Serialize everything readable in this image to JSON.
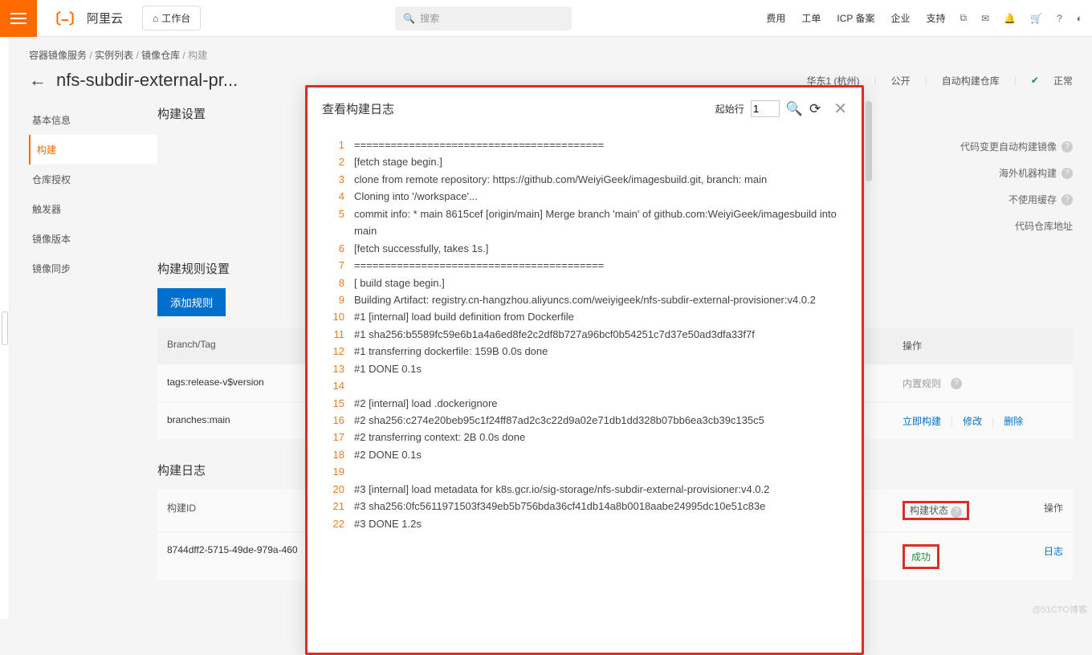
{
  "nav": {
    "brand": "阿里云",
    "workbench": "工作台",
    "search_placeholder": "搜索",
    "links": [
      "费用",
      "工单",
      "ICP 备案",
      "企业",
      "支持"
    ]
  },
  "breadcrumb": {
    "a": "容器镜像服务",
    "b": "实例列表",
    "c": "镜像仓库",
    "d": "构建"
  },
  "page": {
    "title": "nfs-subdir-external-pr...",
    "region": "华东1 (杭州)",
    "visibility": "公开",
    "repo_type": "自动构建仓库",
    "status": "正常"
  },
  "side_tabs": [
    "基本信息",
    "构建",
    "仓库授权",
    "触发器",
    "镜像版本",
    "镜像同步"
  ],
  "settings": {
    "title": "构建设置",
    "rows": [
      "代码变更自动构建镜像",
      "海外机器构建",
      "不使用缓存",
      "代码仓库地址"
    ]
  },
  "rules": {
    "title": "构建规则设置",
    "add_btn": "添加规则",
    "col_left": "Branch/Tag",
    "col_right": "操作",
    "r1_left": "tags:release-v$version",
    "r1_right": "内置规则",
    "r2_left": "branches:main",
    "r2_actions": [
      "立即构建",
      "修改",
      "删除"
    ]
  },
  "buildlog": {
    "title": "构建日志",
    "col_id": "构建ID",
    "col_status": "构建状态",
    "col_op": "操作",
    "row_id": "8744dff2-5715-49de-979a-460",
    "row_status": "成功",
    "row_op": "日志"
  },
  "modal": {
    "title": "查看构建日志",
    "start_label": "起始行",
    "start_value": "1",
    "lines": [
      "=========================================",
      "[fetch stage begin.]",
      "clone from remote repository: https://github.com/WeiyiGeek/imagesbuild.git, branch: main",
      "Cloning into '/workspace'...",
      "commit info: * main 8615cef [origin/main] Merge branch 'main' of github.com:WeiyiGeek/imagesbuild into main",
      "[fetch successfully, takes 1s.]",
      "=========================================",
      "[ build stage begin.]",
      "Building Artifact: registry.cn-hangzhou.aliyuncs.com/weiyigeek/nfs-subdir-external-provisioner:v4.0.2",
      "#1 [internal] load build definition from Dockerfile",
      "#1 sha256:b5589fc59e6b1a4a6ed8fe2c2df8b727a96bcf0b54251c7d37e50ad3dfa33f7f",
      "#1 transferring dockerfile: 159B 0.0s done",
      "#1 DONE 0.1s",
      "",
      "#2 [internal] load .dockerignore",
      "#2 sha256:c274e20beb95c1f24ff87ad2c3c22d9a02e71db1dd328b07bb6ea3cb39c135c5",
      "#2 transferring context: 2B 0.0s done",
      "#2 DONE 0.1s",
      "",
      "#3 [internal] load metadata for k8s.gcr.io/sig-storage/nfs-subdir-external-provisioner:v4.0.2",
      "#3 sha256:0fc5611971503f349eb5b756bda36cf41db14a8b0018aabe24995dc10e51c83e",
      "#3 DONE 1.2s"
    ]
  },
  "watermark": "@51CTO博客"
}
